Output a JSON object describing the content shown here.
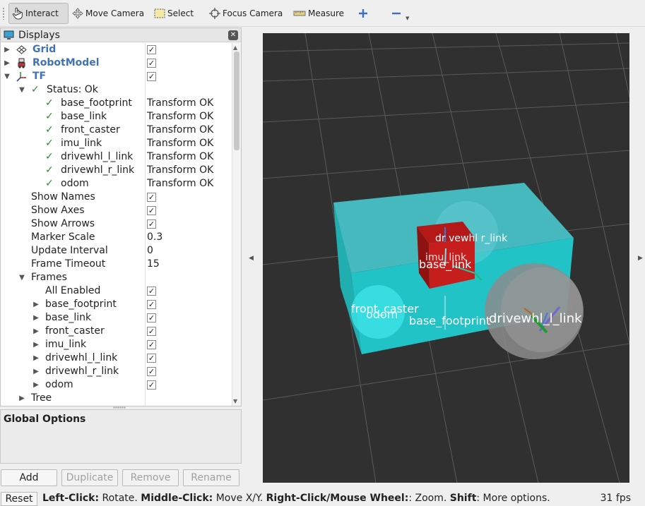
{
  "toolbar": {
    "interact": "Interact",
    "move_camera": "Move Camera",
    "select": "Select",
    "focus_camera": "Focus Camera",
    "measure": "Measure"
  },
  "displays": {
    "title": "Displays",
    "rows": [
      {
        "label": "Grid",
        "checked": true
      },
      {
        "label": "RobotModel",
        "checked": true
      },
      {
        "label": "TF",
        "checked": true
      },
      {
        "label": "Status: Ok"
      },
      {
        "label": "base_footprint",
        "value": "Transform OK"
      },
      {
        "label": "base_link",
        "value": "Transform OK"
      },
      {
        "label": "front_caster",
        "value": "Transform OK"
      },
      {
        "label": "imu_link",
        "value": "Transform OK"
      },
      {
        "label": "drivewhl_l_link",
        "value": "Transform OK"
      },
      {
        "label": "drivewhl_r_link",
        "value": "Transform OK"
      },
      {
        "label": "odom",
        "value": "Transform OK"
      },
      {
        "label": "Show Names",
        "checked": true
      },
      {
        "label": "Show Axes",
        "checked": true
      },
      {
        "label": "Show Arrows",
        "checked": true
      },
      {
        "label": "Marker Scale",
        "value": "0.3"
      },
      {
        "label": "Update Interval",
        "value": "0"
      },
      {
        "label": "Frame Timeout",
        "value": "15"
      },
      {
        "label": "Frames"
      },
      {
        "label": "All Enabled",
        "checked": true
      },
      {
        "label": "base_footprint",
        "checked": true
      },
      {
        "label": "base_link",
        "checked": true
      },
      {
        "label": "front_caster",
        "checked": true
      },
      {
        "label": "imu_link",
        "checked": true
      },
      {
        "label": "drivewhl_l_link",
        "checked": true
      },
      {
        "label": "drivewhl_r_link",
        "checked": true
      },
      {
        "label": "odom",
        "checked": true
      },
      {
        "label": "Tree"
      }
    ]
  },
  "global_options": {
    "title": "Global Options"
  },
  "buttons": {
    "add": "Add",
    "duplicate": "Duplicate",
    "remove": "Remove",
    "rename": "Rename"
  },
  "status": {
    "reset": "Reset",
    "hint_parts": [
      {
        "text": "Left-Click:",
        "bold": true
      },
      {
        "text": " Rotate. ",
        "bold": false
      },
      {
        "text": "Middle-Click:",
        "bold": true
      },
      {
        "text": " Move X/Y. ",
        "bold": false
      },
      {
        "text": "Right-Click/Mouse Wheel:",
        "bold": true
      },
      {
        "text": ": Zoom. ",
        "bold": false
      },
      {
        "text": "Shift",
        "bold": true
      },
      {
        "text": ": More options.",
        "bold": false
      }
    ],
    "fps": "31 fps"
  },
  "view3d": {
    "labels": {
      "drivewhl_r": "dr vewhl r_link",
      "imu": "imu_link",
      "base_link": "base_link",
      "front_caster": "front_caster",
      "odom": "odom",
      "base_footprint": "base_footprint",
      "drivewhl_l": "drivewhl_l_link"
    },
    "colors": {
      "background": "#303030",
      "chassis": "#21c3c6",
      "imu_box": "#c01a1a",
      "wheel": "#8c8c8c"
    }
  }
}
